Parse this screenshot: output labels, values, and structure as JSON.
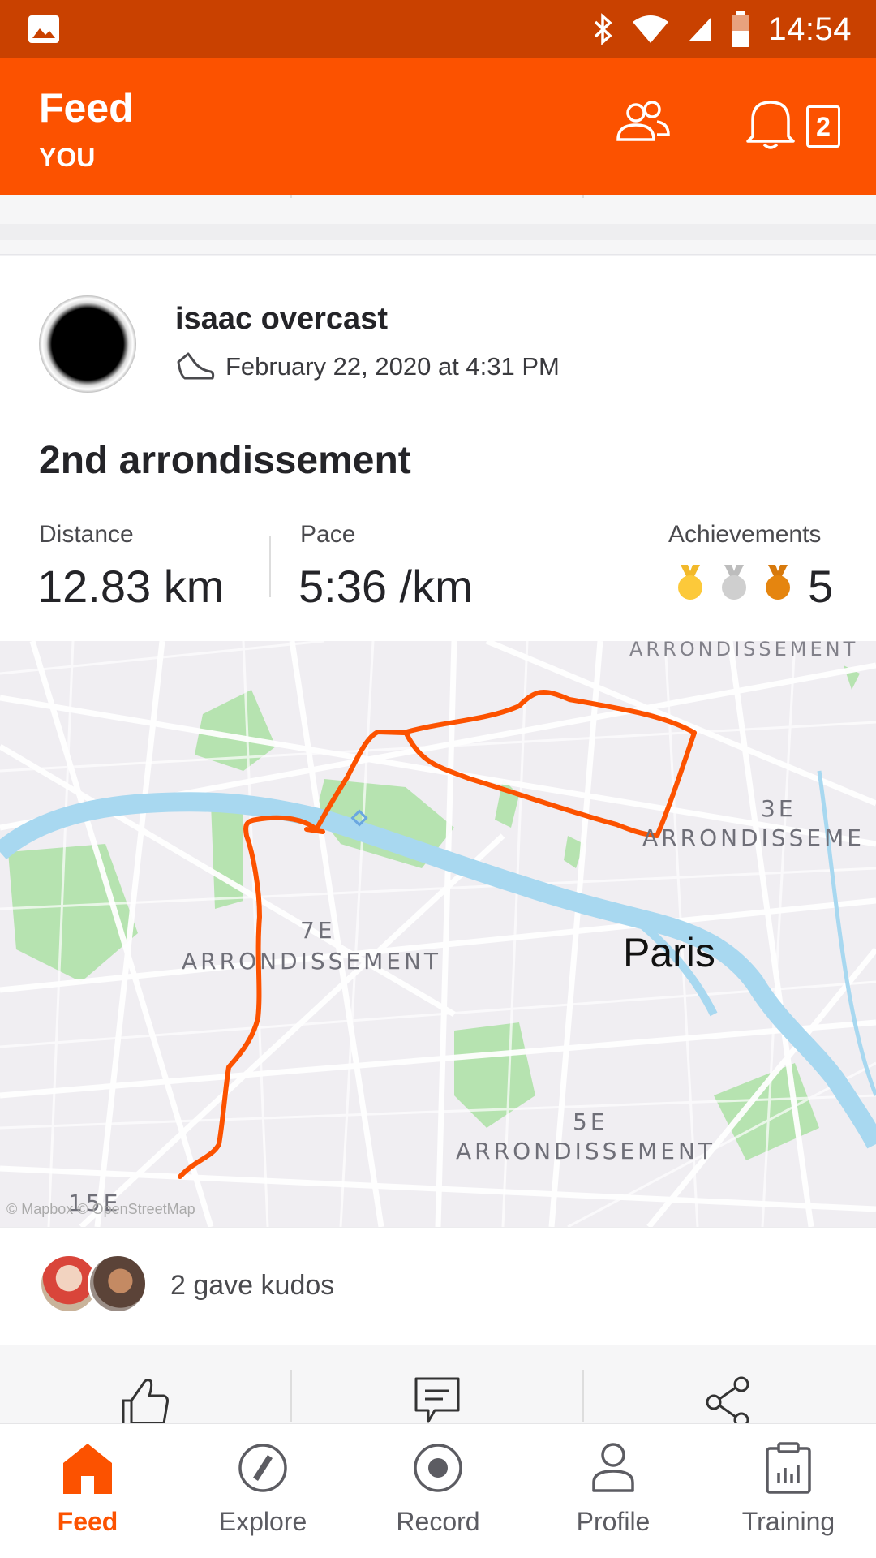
{
  "status_bar": {
    "time": "14:54"
  },
  "header": {
    "title": "Feed",
    "subtitle": "YOU",
    "notification_count": "2"
  },
  "activity": {
    "athlete_name": "isaac overcast",
    "datetime": "February 22, 2020 at 4:31 PM",
    "title": "2nd arrondissement",
    "stats": [
      {
        "label": "Distance",
        "value": "12.83 km"
      },
      {
        "label": "Pace",
        "value": "5:36 /km"
      }
    ],
    "achievements": {
      "label": "Achievements",
      "count": "5",
      "medals": [
        "gold",
        "silver",
        "bronze"
      ]
    }
  },
  "map": {
    "labels": {
      "arr7_num": "7E",
      "arr7_name": "ARRONDISSEMENT",
      "arr3_num": "3E",
      "arr3_name": "ARRONDISSEME",
      "arr5_num": "5E",
      "arr5_name": "ARRONDISSEMENT",
      "arr15_num": "15E",
      "top_edge": "ARRONDISSEMENT",
      "city": "Paris"
    },
    "attribution": "© Mapbox © OpenStreetMap",
    "route_color": "#fc5200"
  },
  "kudos": {
    "text": "2 gave kudos"
  },
  "actions": [
    "kudos-icon",
    "comment-icon",
    "share-icon"
  ],
  "tabs": [
    {
      "label": "Feed",
      "icon": "home-icon",
      "active": true
    },
    {
      "label": "Explore",
      "icon": "compass-icon",
      "active": false
    },
    {
      "label": "Record",
      "icon": "record-icon",
      "active": false
    },
    {
      "label": "Profile",
      "icon": "person-icon",
      "active": false
    },
    {
      "label": "Training",
      "icon": "clipboard-chart-icon",
      "active": false
    }
  ],
  "colors": {
    "brand": "#fc5200",
    "status_bar": "#c94100",
    "river": "#a8d8f0",
    "park": "#b6e3b0"
  }
}
